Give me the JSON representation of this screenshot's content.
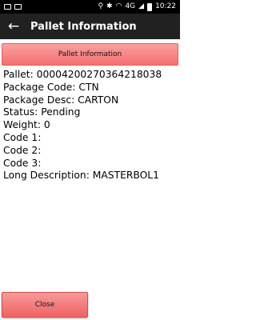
{
  "status_bar": {
    "time": "10:22",
    "network": "4G",
    "icons": [
      "mail-icon",
      "gallery-icon",
      "location-icon",
      "bluetooth-icon",
      "wifi-icon",
      "signal-icon",
      "battery-icon"
    ]
  },
  "app_bar": {
    "title": "Pallet Information",
    "back_icon": "arrow-back-icon"
  },
  "section_header": "Pallet Information",
  "details": [
    {
      "label": "Pallet",
      "value": "000042002703642180​38",
      "text": "Pallet: 00004200270364218038"
    },
    {
      "label": "Package Code",
      "value": "CTN",
      "text": "Package Code: CTN"
    },
    {
      "label": "Package Desc",
      "value": "CARTON",
      "text": "Package Desc: CARTON"
    },
    {
      "label": "Status",
      "value": "Pending",
      "text": "Status: Pending"
    },
    {
      "label": "Weight",
      "value": "0",
      "text": "Weight: 0"
    },
    {
      "label": "Code 1",
      "value": "",
      "text": "Code 1:"
    },
    {
      "label": "Code 2",
      "value": "",
      "text": "Code 2:"
    },
    {
      "label": "Code 3",
      "value": "",
      "text": "Code 3:"
    },
    {
      "label": "Long Description",
      "value": "MASTERBOL1",
      "text": "Long Description: MASTERBOL1"
    }
  ],
  "close_button": "Close",
  "colors": {
    "app_bar": "#212121",
    "accent_red": "#f46f6f",
    "status_bar": "#000000"
  }
}
